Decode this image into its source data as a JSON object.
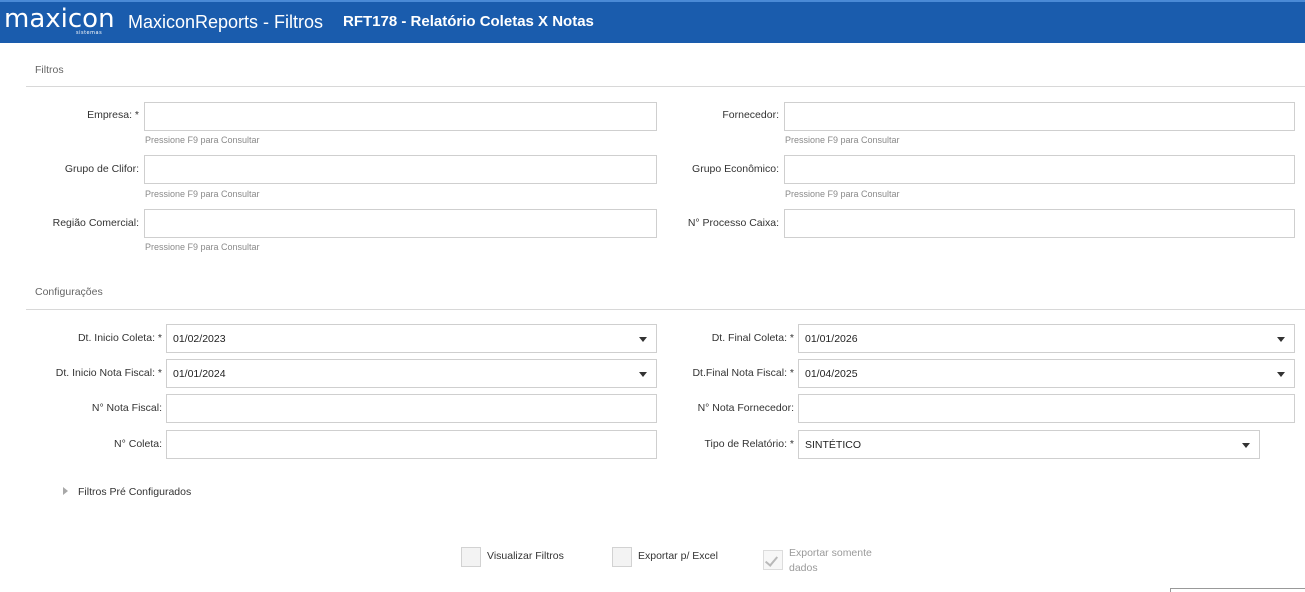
{
  "header": {
    "logo": "maxicon",
    "logo_sub": "sistemas",
    "app_title": "MaxiconReports - Filtros",
    "report_title": "RFT178 - Relatório Coletas X Notas",
    "bg_color": "#1a5cad"
  },
  "filtros": {
    "section_title": "Filtros",
    "fields": {
      "empresa": {
        "label": "Empresa: *",
        "value": "",
        "hint": "Pressione F9 para Consultar"
      },
      "fornecedor": {
        "label": "Fornecedor:",
        "value": "",
        "hint": "Pressione F9 para Consultar"
      },
      "grupo_clifor": {
        "label": "Grupo de Clifor:",
        "value": "",
        "hint": "Pressione F9 para Consultar"
      },
      "grupo_economico": {
        "label": "Grupo Econômico:",
        "value": "",
        "hint": "Pressione F9 para Consultar"
      },
      "regiao_comercial": {
        "label": "Região Comercial:",
        "value": "",
        "hint": "Pressione F9 para Consultar"
      },
      "processo_caixa": {
        "label": "N° Processo Caixa:",
        "value": ""
      }
    }
  },
  "configuracoes": {
    "section_title": "Configurações",
    "fields": {
      "dt_inicio_coleta": {
        "label": "Dt. Inicio Coleta: *",
        "value": "01/02/2023"
      },
      "dt_final_coleta": {
        "label": "Dt. Final Coleta: *",
        "value": "01/01/2026"
      },
      "dt_inicio_nf": {
        "label": "Dt. Inicio Nota Fiscal: *",
        "value": "01/01/2024"
      },
      "dt_final_nf": {
        "label": "Dt.Final Nota Fiscal: *",
        "value": "01/04/2025"
      },
      "nota_fiscal": {
        "label": "N° Nota Fiscal:",
        "value": ""
      },
      "nota_fornecedor": {
        "label": "N° Nota Fornecedor:",
        "value": ""
      },
      "coleta": {
        "label": "N° Coleta:",
        "value": ""
      },
      "tipo_relatorio": {
        "label": "Tipo de Relatório: *",
        "value": "SINTÉTICO"
      }
    }
  },
  "preconfig": {
    "label": "Filtros Pré Configurados",
    "expanded": false
  },
  "options": {
    "visualizar_filtros": {
      "label": "Visualizar Filtros",
      "checked": false
    },
    "exportar_excel": {
      "label": "Exportar p/ Excel",
      "checked": false
    },
    "exportar_somente_dados": {
      "label_line1": "Exportar somente",
      "label_line2": "dados",
      "checked": true,
      "disabled": true
    }
  }
}
